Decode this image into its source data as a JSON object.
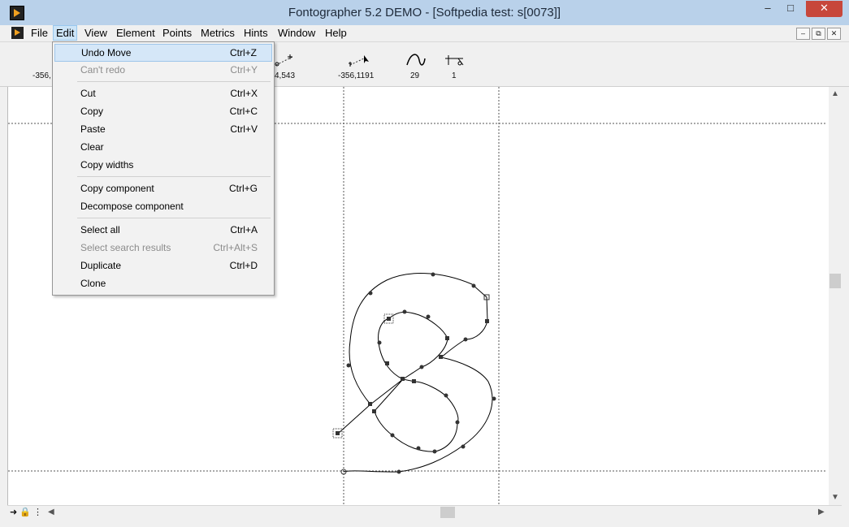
{
  "window": {
    "title": "Fontographer 5.2 DEMO - [Softpedia test: s[0073]]",
    "minimize": "–",
    "maximize": "□",
    "close": "✕"
  },
  "menubar": {
    "items": [
      "File",
      "Edit",
      "View",
      "Element",
      "Points",
      "Metrics",
      "Hints",
      "Window",
      "Help"
    ],
    "mdi_min": "–",
    "mdi_restore": "⧉",
    "mdi_close": "✕"
  },
  "toolbar": {
    "values": [
      "-356,",
      "4,543",
      "-356,1191",
      "29",
      "1"
    ]
  },
  "edit_menu": {
    "items": [
      {
        "label": "Undo Move",
        "shortcut": "Ctrl+Z",
        "state": "highlighted"
      },
      {
        "label": "Can't redo",
        "shortcut": "Ctrl+Y",
        "state": "disabled"
      },
      {
        "label": "Cut",
        "shortcut": "Ctrl+X",
        "state": "enabled"
      },
      {
        "label": "Copy",
        "shortcut": "Ctrl+C",
        "state": "enabled"
      },
      {
        "label": "Paste",
        "shortcut": "Ctrl+V",
        "state": "enabled"
      },
      {
        "label": "Clear",
        "shortcut": "",
        "state": "enabled"
      },
      {
        "label": "Copy widths",
        "shortcut": "",
        "state": "enabled"
      },
      {
        "label": "Copy component",
        "shortcut": "Ctrl+G",
        "state": "enabled"
      },
      {
        "label": "Decompose component",
        "shortcut": "",
        "state": "enabled"
      },
      {
        "label": "Select all",
        "shortcut": "Ctrl+A",
        "state": "enabled"
      },
      {
        "label": "Select search results",
        "shortcut": "Ctrl+Alt+S",
        "state": "disabled"
      },
      {
        "label": "Duplicate",
        "shortcut": "Ctrl+D",
        "state": "enabled"
      },
      {
        "label": "Clone",
        "shortcut": "",
        "state": "enabled"
      }
    ]
  },
  "icons": {
    "app": "fontographer-app-icon",
    "toolbar": [
      "point-cursor-icon",
      "node-pair-icon",
      "measure-arrow-icon",
      "curve-icon",
      "hint-icon"
    ],
    "status": [
      "arrow-right-icon",
      "lock-icon",
      "grid-dots-icon"
    ]
  }
}
